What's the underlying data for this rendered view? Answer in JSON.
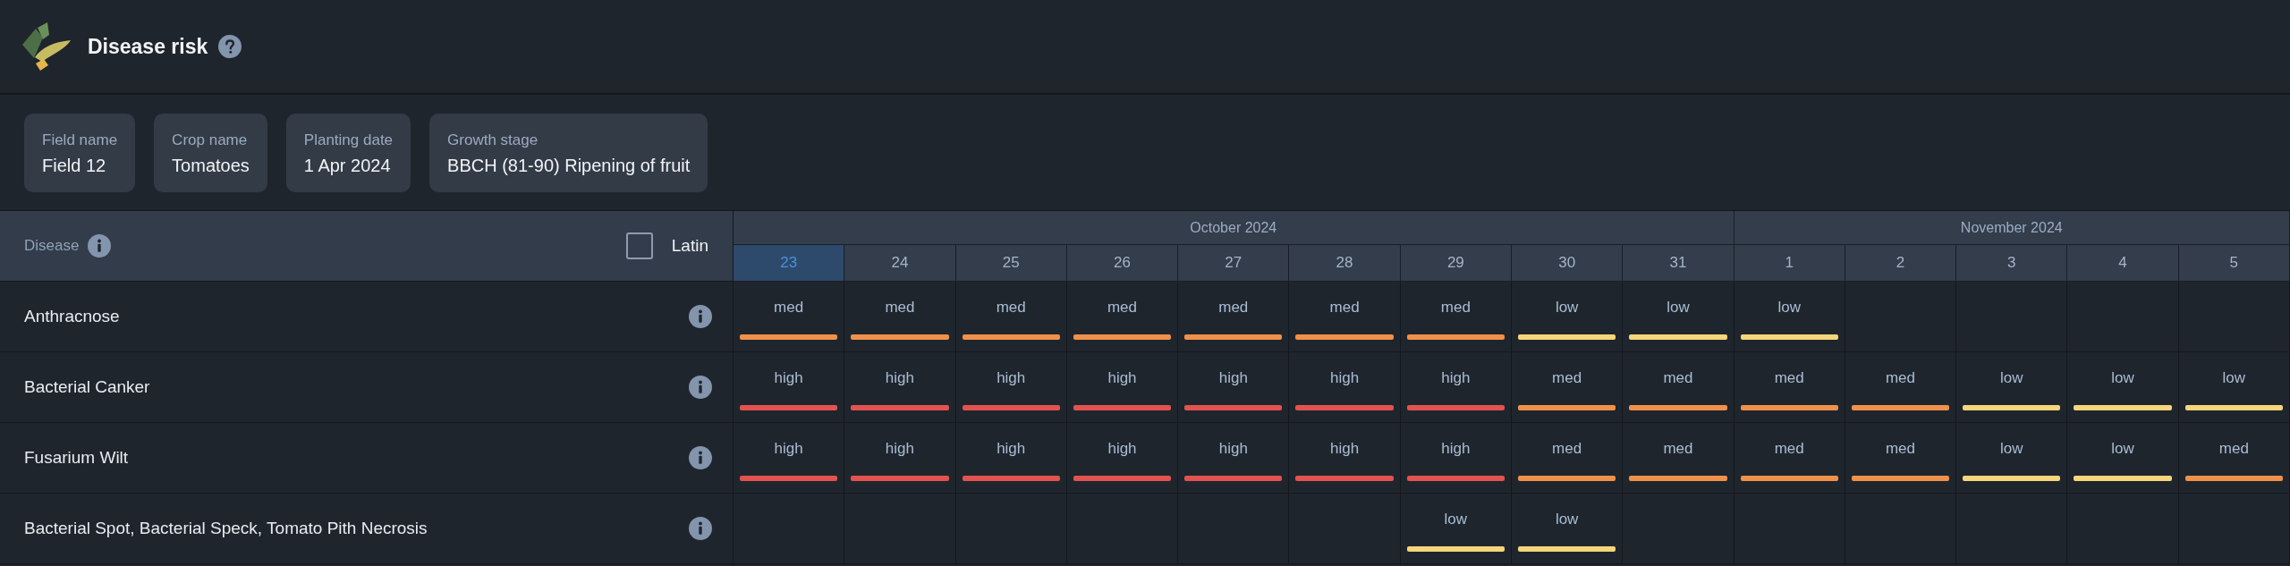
{
  "header": {
    "title": "Disease risk"
  },
  "field_info": [
    {
      "label": "Field name",
      "value": "Field 12"
    },
    {
      "label": "Crop name",
      "value": "Tomatoes"
    },
    {
      "label": "Planting date",
      "value": "1 Apr 2024"
    },
    {
      "label": "Growth stage",
      "value": "BBCH (81-90) Ripening of fruit"
    }
  ],
  "table": {
    "disease_column": {
      "label": "Disease"
    },
    "latin_toggle": {
      "label": "Latin",
      "checked": false
    },
    "months": [
      {
        "label": "October 2024",
        "days": [
          {
            "label": "23",
            "selected": true
          },
          {
            "label": "24",
            "selected": false
          },
          {
            "label": "25",
            "selected": false
          },
          {
            "label": "26",
            "selected": false
          },
          {
            "label": "27",
            "selected": false
          },
          {
            "label": "28",
            "selected": false
          },
          {
            "label": "29",
            "selected": false
          },
          {
            "label": "30",
            "selected": false
          },
          {
            "label": "31",
            "selected": false
          }
        ]
      },
      {
        "label": "November 2024",
        "days": [
          {
            "label": "1",
            "selected": false
          },
          {
            "label": "2",
            "selected": false
          },
          {
            "label": "3",
            "selected": false
          },
          {
            "label": "4",
            "selected": false
          },
          {
            "label": "5",
            "selected": false
          }
        ]
      }
    ],
    "rows": [
      {
        "disease": "Anthracnose",
        "risks": [
          {
            "kind": "risk",
            "label": "med",
            "color": "#f0914b"
          },
          {
            "kind": "risk",
            "label": "med",
            "color": "#f0914b"
          },
          {
            "kind": "risk",
            "label": "med",
            "color": "#f0914b"
          },
          {
            "kind": "risk",
            "label": "med",
            "color": "#f0914b"
          },
          {
            "kind": "risk",
            "label": "med",
            "color": "#f0914b"
          },
          {
            "kind": "risk",
            "label": "med",
            "color": "#f0914b"
          },
          {
            "kind": "risk",
            "label": "med",
            "color": "#f0914b"
          },
          {
            "kind": "risk",
            "label": "low",
            "color": "#f7d57a"
          },
          {
            "kind": "risk",
            "label": "low",
            "color": "#f7d57a"
          },
          {
            "kind": "risk",
            "label": "low",
            "color": "#f7d57a"
          },
          {
            "kind": "empty"
          },
          {
            "kind": "empty"
          },
          {
            "kind": "empty"
          },
          {
            "kind": "empty"
          }
        ]
      },
      {
        "disease": "Bacterial Canker",
        "risks": [
          {
            "kind": "risk",
            "label": "high",
            "color": "#e2534f"
          },
          {
            "kind": "risk",
            "label": "high",
            "color": "#e2534f"
          },
          {
            "kind": "risk",
            "label": "high",
            "color": "#e2534f"
          },
          {
            "kind": "risk",
            "label": "high",
            "color": "#e2534f"
          },
          {
            "kind": "risk",
            "label": "high",
            "color": "#e2534f"
          },
          {
            "kind": "risk",
            "label": "high",
            "color": "#e2534f"
          },
          {
            "kind": "risk",
            "label": "high",
            "color": "#e2534f"
          },
          {
            "kind": "risk",
            "label": "med",
            "color": "#f0914b"
          },
          {
            "kind": "risk",
            "label": "med",
            "color": "#f0914b"
          },
          {
            "kind": "risk",
            "label": "med",
            "color": "#f0914b"
          },
          {
            "kind": "risk",
            "label": "med",
            "color": "#f0914b"
          },
          {
            "kind": "risk",
            "label": "low",
            "color": "#f7d57a"
          },
          {
            "kind": "risk",
            "label": "low",
            "color": "#f7d57a"
          },
          {
            "kind": "risk",
            "label": "low",
            "color": "#f7d57a"
          }
        ]
      },
      {
        "disease": "Fusarium Wilt",
        "risks": [
          {
            "kind": "risk",
            "label": "high",
            "color": "#e2534f"
          },
          {
            "kind": "risk",
            "label": "high",
            "color": "#e2534f"
          },
          {
            "kind": "risk",
            "label": "high",
            "color": "#e2534f"
          },
          {
            "kind": "risk",
            "label": "high",
            "color": "#e2534f"
          },
          {
            "kind": "risk",
            "label": "high",
            "color": "#e2534f"
          },
          {
            "kind": "risk",
            "label": "high",
            "color": "#e2534f"
          },
          {
            "kind": "risk",
            "label": "high",
            "color": "#e2534f"
          },
          {
            "kind": "risk",
            "label": "med",
            "color": "#f0914b"
          },
          {
            "kind": "risk",
            "label": "med",
            "color": "#f0914b"
          },
          {
            "kind": "risk",
            "label": "med",
            "color": "#f0914b"
          },
          {
            "kind": "risk",
            "label": "med",
            "color": "#f0914b"
          },
          {
            "kind": "risk",
            "label": "low",
            "color": "#f7d57a"
          },
          {
            "kind": "risk",
            "label": "low",
            "color": "#f7d57a"
          },
          {
            "kind": "risk",
            "label": "med",
            "color": "#f0914b"
          }
        ]
      },
      {
        "disease": "Bacterial Spot, Bacterial Speck, Tomato Pith Necrosis",
        "risks": [
          {
            "kind": "empty"
          },
          {
            "kind": "empty"
          },
          {
            "kind": "empty"
          },
          {
            "kind": "empty"
          },
          {
            "kind": "empty"
          },
          {
            "kind": "empty"
          },
          {
            "kind": "risk",
            "label": "low",
            "color": "#f7d57a"
          },
          {
            "kind": "risk",
            "label": "low",
            "color": "#f7d57a"
          },
          {
            "kind": "empty"
          },
          {
            "kind": "empty"
          },
          {
            "kind": "empty"
          },
          {
            "kind": "empty"
          },
          {
            "kind": "empty"
          },
          {
            "kind": "empty"
          }
        ]
      }
    ]
  }
}
